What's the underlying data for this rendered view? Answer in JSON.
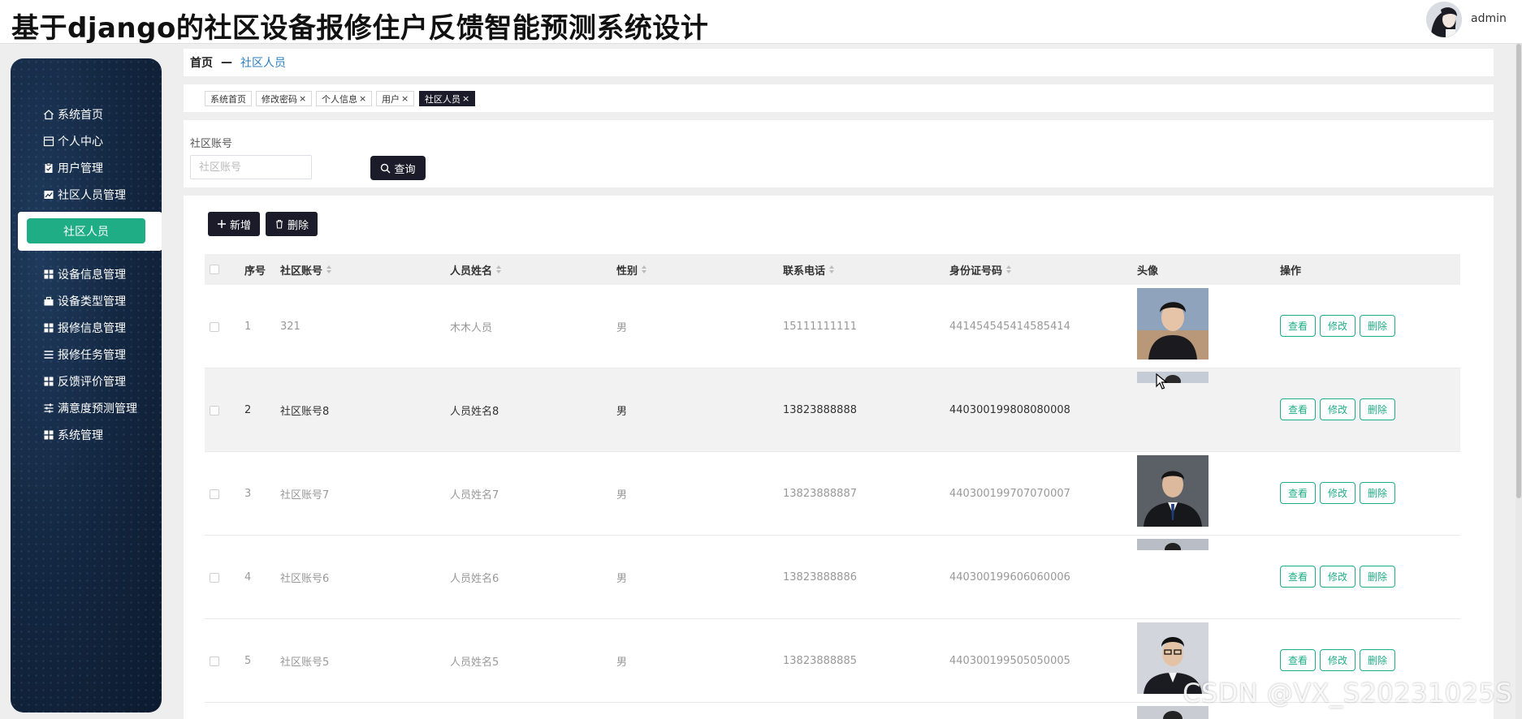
{
  "header": {
    "title": "基于django的社区设备报修住户反馈智能预测系统设计",
    "username": "admin"
  },
  "sidebar": {
    "items": [
      {
        "label": "系统首页",
        "icon": "home-icon"
      },
      {
        "label": "个人中心",
        "icon": "calendar-icon"
      },
      {
        "label": "用户管理",
        "icon": "clipboard-icon"
      },
      {
        "label": "社区人员管理",
        "icon": "chart-icon"
      },
      {
        "label": "设备信息管理",
        "icon": "grid-icon"
      },
      {
        "label": "设备类型管理",
        "icon": "briefcase-icon"
      },
      {
        "label": "报修信息管理",
        "icon": "grid-icon"
      },
      {
        "label": "报修任务管理",
        "icon": "list-icon"
      },
      {
        "label": "反馈评价管理",
        "icon": "grid-icon"
      },
      {
        "label": "满意度预测管理",
        "icon": "sliders-icon"
      },
      {
        "label": "系统管理",
        "icon": "grid-icon"
      }
    ],
    "submenu_active": "社区人员"
  },
  "breadcrumb": {
    "home": "首页",
    "separator": "—",
    "current": "社区人员"
  },
  "tabs": [
    {
      "label": "系统首页",
      "closable": false,
      "active": false
    },
    {
      "label": "修改密码",
      "closable": true,
      "active": false
    },
    {
      "label": "个人信息",
      "closable": true,
      "active": false
    },
    {
      "label": "用户",
      "closable": true,
      "active": false
    },
    {
      "label": "社区人员",
      "closable": true,
      "active": true
    }
  ],
  "tab_close_glyph": "×",
  "search": {
    "label": "社区账号",
    "placeholder": "社区账号",
    "button": "查询"
  },
  "toolbar": {
    "add": "新增",
    "delete": "删除"
  },
  "table": {
    "headers": {
      "index": "序号",
      "account": "社区账号",
      "name": "人员姓名",
      "gender": "性别",
      "phone": "联系电话",
      "idcard": "身份证号码",
      "avatar": "头像",
      "ops": "操作"
    },
    "rows": [
      {
        "index": "1",
        "account": "321",
        "name": "木木人员",
        "gender": "男",
        "phone": "15111111111",
        "idcard": "441454545414585414"
      },
      {
        "index": "2",
        "account": "社区账号8",
        "name": "人员姓名8",
        "gender": "男",
        "phone": "13823888888",
        "idcard": "440300199808080008"
      },
      {
        "index": "3",
        "account": "社区账号7",
        "name": "人员姓名7",
        "gender": "男",
        "phone": "13823888887",
        "idcard": "440300199707070007"
      },
      {
        "index": "4",
        "account": "社区账号6",
        "name": "人员姓名6",
        "gender": "男",
        "phone": "13823888886",
        "idcard": "440300199606060006"
      },
      {
        "index": "5",
        "account": "社区账号5",
        "name": "人员姓名5",
        "gender": "男",
        "phone": "13823888885",
        "idcard": "440300199505050005"
      }
    ],
    "row_ops": {
      "view": "查看",
      "edit": "修改",
      "delete": "删除"
    }
  },
  "watermark": "CSDN @VX_S20231025S",
  "colors": {
    "accent": "#1fad86",
    "dark": "#1b1b2a",
    "link": "#2a7fbf"
  }
}
